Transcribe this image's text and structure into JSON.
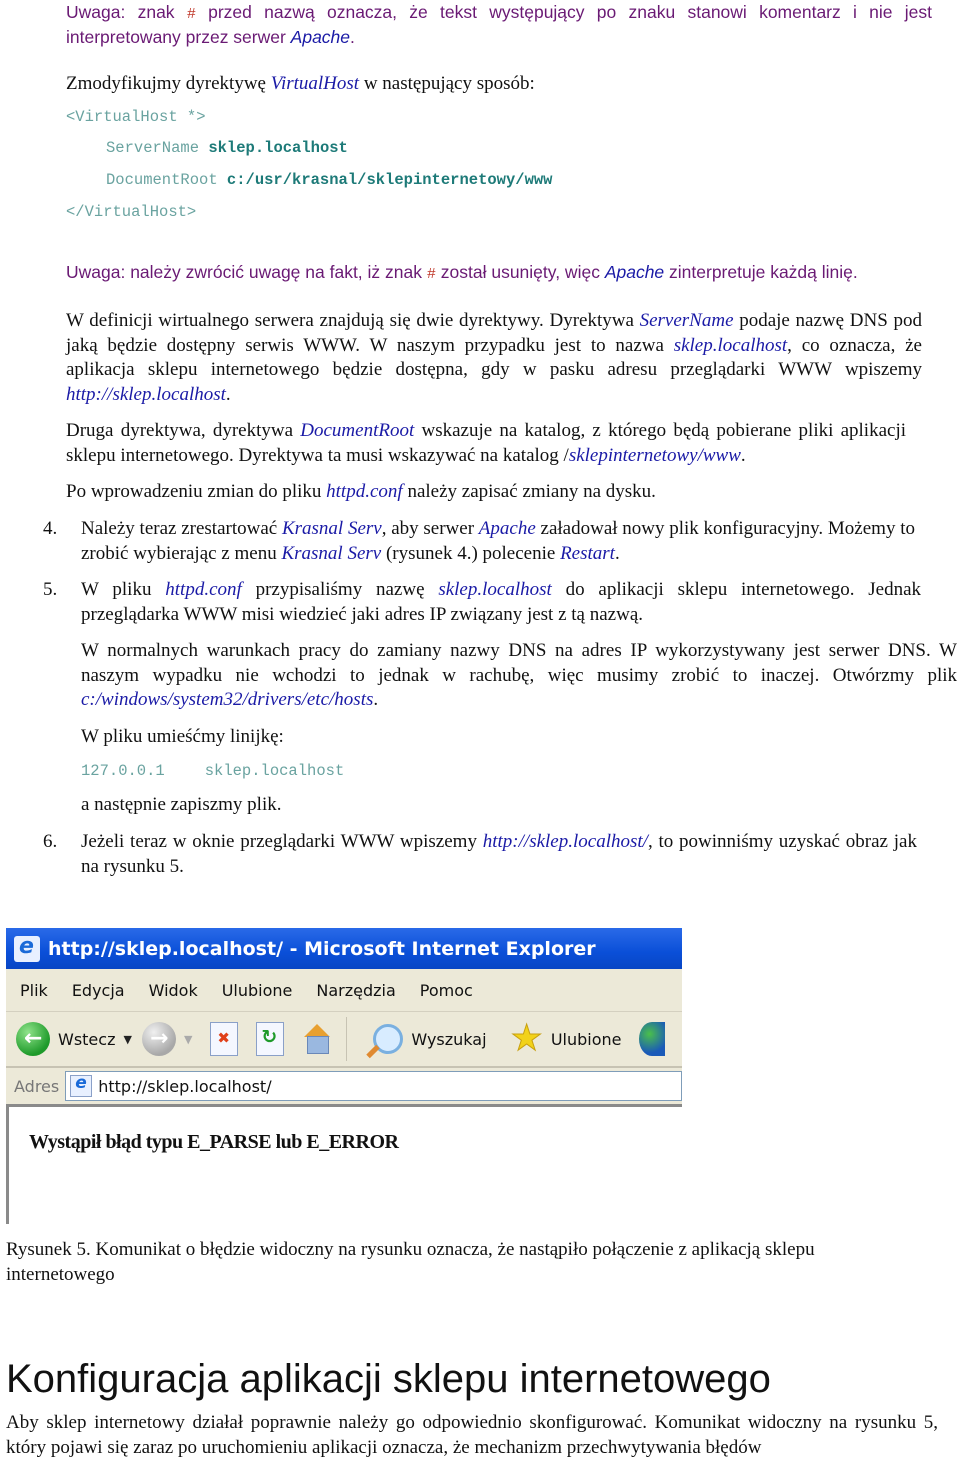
{
  "note1": {
    "part1": "Uwaga: znak ",
    "hash": "#",
    "part2": " przed nazwą oznacza, że tekst występujący po znaku stanowi komentarz i nie jest interpretowany przez serwer ",
    "apache": "Apache",
    "end": "."
  },
  "intro": {
    "part1": "Zmodyfikujmy dyrektywę ",
    "virtualhost": "VirtualHost",
    "part2": " w następujący sposób:"
  },
  "code_block": {
    "open": "<VirtualHost *>",
    "servername_key": "ServerName ",
    "servername_val": "sklep.localhost",
    "docroot_key": "DocumentRoot ",
    "docroot_val": "c:/usr/krasnal/sklepinternetowy/www",
    "close": "</VirtualHost>"
  },
  "note2": {
    "part1": "Uwaga: należy zwrócić uwagę na fakt, iż znak ",
    "hash": "#",
    "part2": " został usunięty, więc ",
    "apache": "Apache",
    "part3": " zinterpretuje każdą linię."
  },
  "para1": {
    "p1": "W definicji wirtualnego serwera znajdują się dwie dyrektywy. Dyrektywa ",
    "servername": "ServerName",
    "p2": " podaje nazwę DNS pod jaką będzie dostępny serwis WWW. W naszym przypadku jest to nazwa ",
    "sklep": "sklep.localhost",
    "p3": ", co oznacza, że aplikacja sklepu internetowego będzie dostępna, gdy w pasku adresu przeglądarki WWW wpiszemy ",
    "url": "http://sklep.localhost",
    "p4": "."
  },
  "para2": {
    "p1": "Druga dyrektywa, dyrektywa ",
    "docroot": "DocumentRoot",
    "p2": " wskazuje na katalog, z którego będą pobierane pliki aplikacji sklepu internetowego. Dyrektywa ta musi wskazywać na katalog /",
    "path": "sklepinternetowy/www",
    "p3": "."
  },
  "para3": {
    "p1": "Po wprowadzeniu zmian do pliku ",
    "httpd": "httpd.conf",
    "p2": " należy zapisać zmiany na dysku."
  },
  "steps": [
    {
      "number": "4.",
      "p1": "Należy teraz zrestartować ",
      "krasnal": "Krasnal Serv",
      "p2": ", aby serwer ",
      "apache": "Apache",
      "p3": " załadował nowy plik konfiguracyjny. Możemy to zrobić wybierając z menu ",
      "krasnal2": "Krasnal Serv",
      "p4": " (rysunek 4.) polecenie ",
      "restart": "Restart",
      "p5": "."
    },
    {
      "number": "5.",
      "p1": "W pliku ",
      "httpd": "httpd.conf",
      "p2": " przypisaliśmy nazwę ",
      "sklep": "sklep.localhost",
      "p3": " do aplikacji sklepu internetowego. Jednak przeglądarka WWW misi wiedzieć jaki adres IP związany jest z tą nazwą.",
      "sub1_p1": "W normalnych warunkach pracy do zamiany nazwy DNS na adres IP wykorzystywany jest serwer DNS. W naszym wypadku nie wchodzi to jednak w rachubę, więc musimy zrobić to inaczej. Otwórzmy plik ",
      "hosts": "c:/windows/system32/drivers/etc/hosts",
      "sub1_p2": ".",
      "sub2": "W pliku umieśćmy linijkę:",
      "code_ip": "127.0.0.1",
      "code_host": "sklep.localhost",
      "sub3": "a następnie zapiszmy plik."
    },
    {
      "number": "6.",
      "p1": "Jeżeli teraz w oknie przeglądarki WWW wpiszemy ",
      "url": "http://sklep.localhost/",
      "p2": ", to powinniśmy uzyskać obraz jak na rysunku 5."
    }
  ],
  "browser": {
    "title": "http://sklep.localhost/ - Microsoft Internet Explorer",
    "menu": [
      "Plik",
      "Edycja",
      "Widok",
      "Ulubione",
      "Narzędzia",
      "Pomoc"
    ],
    "toolbar": {
      "back": "Wstecz",
      "search": "Wyszukaj",
      "favorites": "Ulubione"
    },
    "address_label": "Adres",
    "address_value": "http://sklep.localhost/",
    "content_message": "Wystąpił błąd typu E_PARSE lub E_ERROR"
  },
  "caption": "Rysunek 5. Komunikat o błędzie widoczny na rysunku oznacza, że nastąpiło połączenie z aplikacją sklepu internetowego",
  "section": {
    "heading": "Konfiguracja aplikacji sklepu internetowego",
    "text": "Aby sklep internetowy działał poprawnie należy go odpowiednio skonfigurować. Komunikat widoczny na rysunku 5, który pojawi się zaraz po uruchomieniu aplikacji oznacza, że mechanizm przechwytywania błędów"
  }
}
